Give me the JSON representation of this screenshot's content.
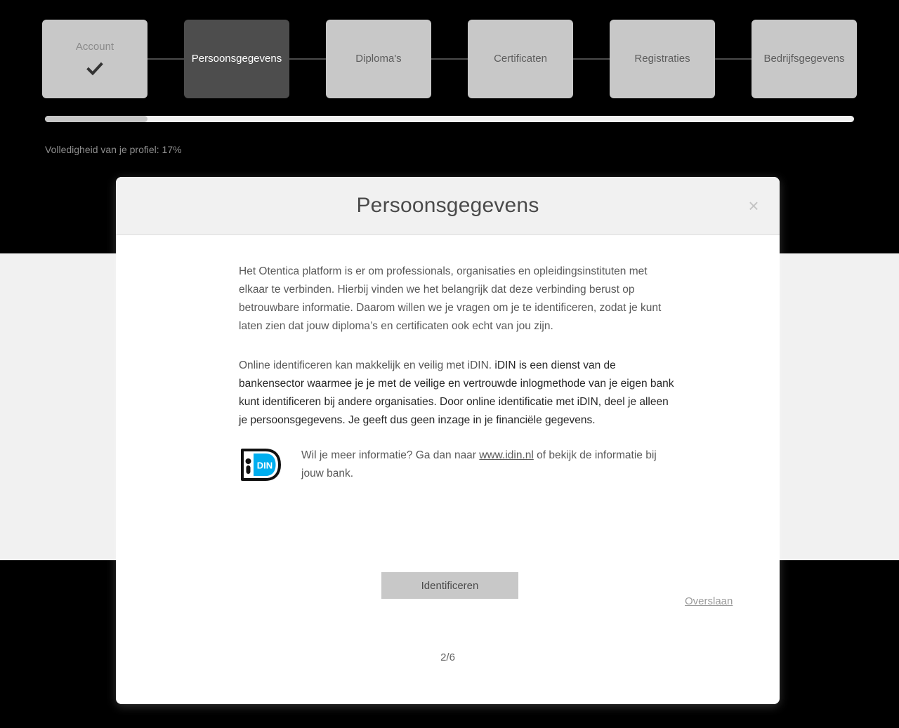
{
  "stepper": {
    "steps": [
      {
        "label": "Account",
        "state": "done",
        "icon": "check-icon"
      },
      {
        "label": "Persoonsgegevens",
        "state": "active",
        "icon": ""
      },
      {
        "label": "Diploma's",
        "state": "todo",
        "icon": ""
      },
      {
        "label": "Certificaten",
        "state": "todo",
        "icon": ""
      },
      {
        "label": "Registraties",
        "state": "todo",
        "icon": ""
      },
      {
        "label": "Bedrijfsgegevens",
        "state": "todo",
        "icon": ""
      }
    ]
  },
  "progress": {
    "label": "Volledigheid van je profiel: 17%",
    "percent": 17,
    "bar_fill_percent": 12.7,
    "track_color": "#f1f1f1",
    "fill_color": "#c6c6c6"
  },
  "modal": {
    "title": "Persoonsgegevens",
    "close_icon": "×",
    "paragraph1": "Het Otentica platform is er om professionals, organisaties en opleidingsinstituten met elkaar te verbinden. Hierbij vinden we het belangrijk dat deze verbinding berust op betrouwbare informatie. Daarom willen we je vragen om je te identificeren, zodat je kunt laten zien dat jouw diploma’s en certificaten ook echt van jou zijn.",
    "paragraph2_lead": "Online identificeren kan makkelijk en veilig met iDIN.",
    "paragraph2_rest": " iDIN is een dienst van de bankensector waarmee je je met de veilige en vertrouwde inlogmethode van je eigen bank kunt identificeren bij andere organisaties. Door online identificatie met iDIN, deel je alleen je persoonsgegevens. Je geeft dus geen inzage in je financiële gegevens.",
    "idin": {
      "logo_name": "idin-logo",
      "logo_text": "DIN",
      "logo_color": "#00aeef",
      "text_before": "Wil je meer informatie? Ga dan naar ",
      "link": "www.idin.nl",
      "text_after": " of bekijk de informatie bij jouw bank."
    },
    "identify_button": "Identificeren",
    "skip_link": "Overslaan",
    "pager": "2/6"
  }
}
